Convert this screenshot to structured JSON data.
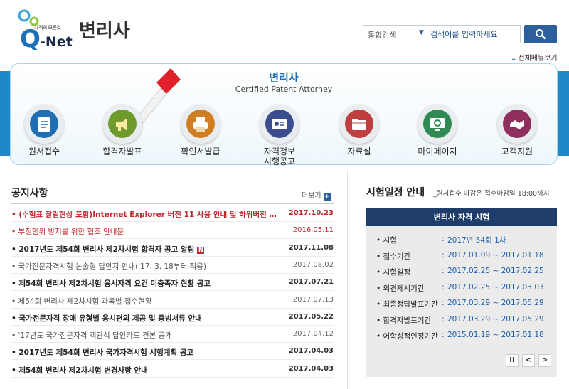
{
  "header": {
    "logo_tagline": "자격의 모든것",
    "logo_q": "Q",
    "logo_net": "-Net",
    "site_title": "변리사",
    "search": {
      "scope": "통합검색",
      "placeholder": "검색어를 입력하세요"
    },
    "all_menu_label": "전체메뉴보기"
  },
  "panel": {
    "title": "변리사",
    "subtitle": "Certified Patent Attorney",
    "menu": [
      {
        "label": "원서접수",
        "icon": "document-icon",
        "color": "#1e6fb3"
      },
      {
        "label": "합격자발표",
        "icon": "megaphone-icon",
        "color": "#6f9a2c"
      },
      {
        "label": "확인서발급",
        "icon": "printer-icon",
        "color": "#d07e22"
      },
      {
        "label": "자격정보\n시행공고",
        "icon": "id-card-icon",
        "color": "#3c4d8f"
      },
      {
        "label": "자료실",
        "icon": "folder-icon",
        "color": "#bf3f3f"
      },
      {
        "label": "마이페이지",
        "icon": "monitor-icon",
        "color": "#2f8a53"
      },
      {
        "label": "고객지원",
        "icon": "handshake-icon",
        "color": "#8e2f5e"
      }
    ]
  },
  "notices": {
    "title": "공지사항",
    "more_label": "더보기",
    "items": [
      {
        "text": "(수험표 잘림현상 포함)Internet Explorer 버전 11 사용 안내 및 하위버전 조치...",
        "date": "2017.10.23",
        "style": "red-bold",
        "badge": ""
      },
      {
        "text": "부정행위 방지를 위한 협조 안내문",
        "date": "2016.05.11",
        "style": "red",
        "badge": ""
      },
      {
        "text": "2017년도 제54회 변리사 제2차시험 합격자 공고 알림",
        "date": "2017.11.08",
        "style": "bold",
        "badge": "N"
      },
      {
        "text": "국가전문자격시험 논술형 답안지 안내('17. 3. 18부터 적용)",
        "date": "2017.08.02",
        "style": "normal",
        "badge": ""
      },
      {
        "text": "제54회 변리사 제2차시험 응시자격 요건 미충족자 현황 공고",
        "date": "2017.07.21",
        "style": "bold",
        "badge": ""
      },
      {
        "text": "제54회 변리사 제2차시험 과목별 접수현황",
        "date": "2017.07.13",
        "style": "normal",
        "badge": ""
      },
      {
        "text": "국가전문자격 장애 유형별 응시편의 제공 및 증빙서류 안내",
        "date": "2017.05.22",
        "style": "bold",
        "badge": ""
      },
      {
        "text": "'17년도 국가전문자격 객관식 답안카드 견본 공개",
        "date": "2017.04.12",
        "style": "normal",
        "badge": ""
      },
      {
        "text": "2017년도 제54회 변리사 국가자격시험 시행계획 공고",
        "date": "2017.04.03",
        "style": "bold",
        "badge": ""
      },
      {
        "text": "제54회 변리사 제2차시험 변경사항 안내",
        "date": "2017.04.03",
        "style": "bold",
        "badge": ""
      }
    ]
  },
  "schedule": {
    "title": "시험일정 안내",
    "subtitle": "_원서접수 마감은 접수마감일 18:00까지",
    "box_title": "변리사 자격 시험",
    "rows": [
      {
        "label": "시험",
        "value": "2017년 54회 1차"
      },
      {
        "label": "접수기간",
        "value": "2017.01.09 ~ 2017.01.18"
      },
      {
        "label": "시험일정",
        "value": "2017.02.25 ~ 2017.02.25"
      },
      {
        "label": "의견제시기간",
        "value": "2017.02.25 ~ 2017.03.03"
      },
      {
        "label": "최종정답발표기간",
        "value": "2017.03.29 ~ 2017.05.29"
      },
      {
        "label": "합격자발표기간",
        "value": "2017.03.29 ~ 2017.05.29"
      },
      {
        "label": "어학성적인정기간",
        "value": "2015.01.19 ~ 2017.01.18"
      }
    ],
    "controls": {
      "pause": "II",
      "prev": "<",
      "next": ">"
    }
  }
}
